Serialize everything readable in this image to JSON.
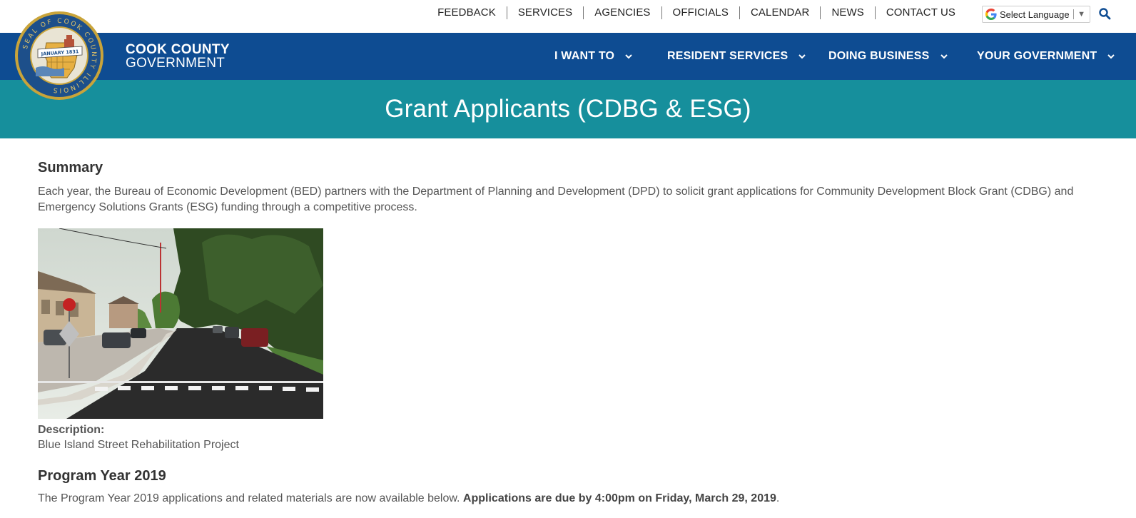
{
  "utility_nav": {
    "links": [
      "FEEDBACK",
      "SERVICES",
      "AGENCIES",
      "OFFICIALS",
      "CALENDAR",
      "NEWS",
      "CONTACT US"
    ],
    "language_select": "Select Language"
  },
  "brand": {
    "line1": "COOK COUNTY",
    "line2": "GOVERNMENT",
    "seal_text": "SEAL OF COOK COUNTY ILLINOIS",
    "seal_date": "JANUARY 1831"
  },
  "main_nav": {
    "items": [
      "I WANT TO",
      "RESIDENT SERVICES",
      "DOING BUSINESS",
      "YOUR GOVERNMENT"
    ]
  },
  "page": {
    "title": "Grant Applicants (CDBG & ESG)"
  },
  "summary": {
    "heading": "Summary",
    "body": "Each year, the Bureau of Economic Development (BED) partners with the Department of Planning and Development (DPD) to solicit grant applications for Community Development Block Grant (CDBG) and Emergency Solutions Grants (ESG) funding through a competitive process.",
    "image_description_label": "Description:",
    "image_description": "Blue Island Street Rehabilitation Project"
  },
  "program_year": {
    "heading": "Program Year 2019",
    "body_start": "The Program Year 2019 applications and related materials are now available below. ",
    "body_bold": "Applications are due by 4:00pm on Friday, March 29, 2019",
    "body_end": "."
  },
  "colors": {
    "nav_blue": "#0e4c92",
    "banner_teal": "#168f9c",
    "seal_gold": "#c9a43a"
  }
}
